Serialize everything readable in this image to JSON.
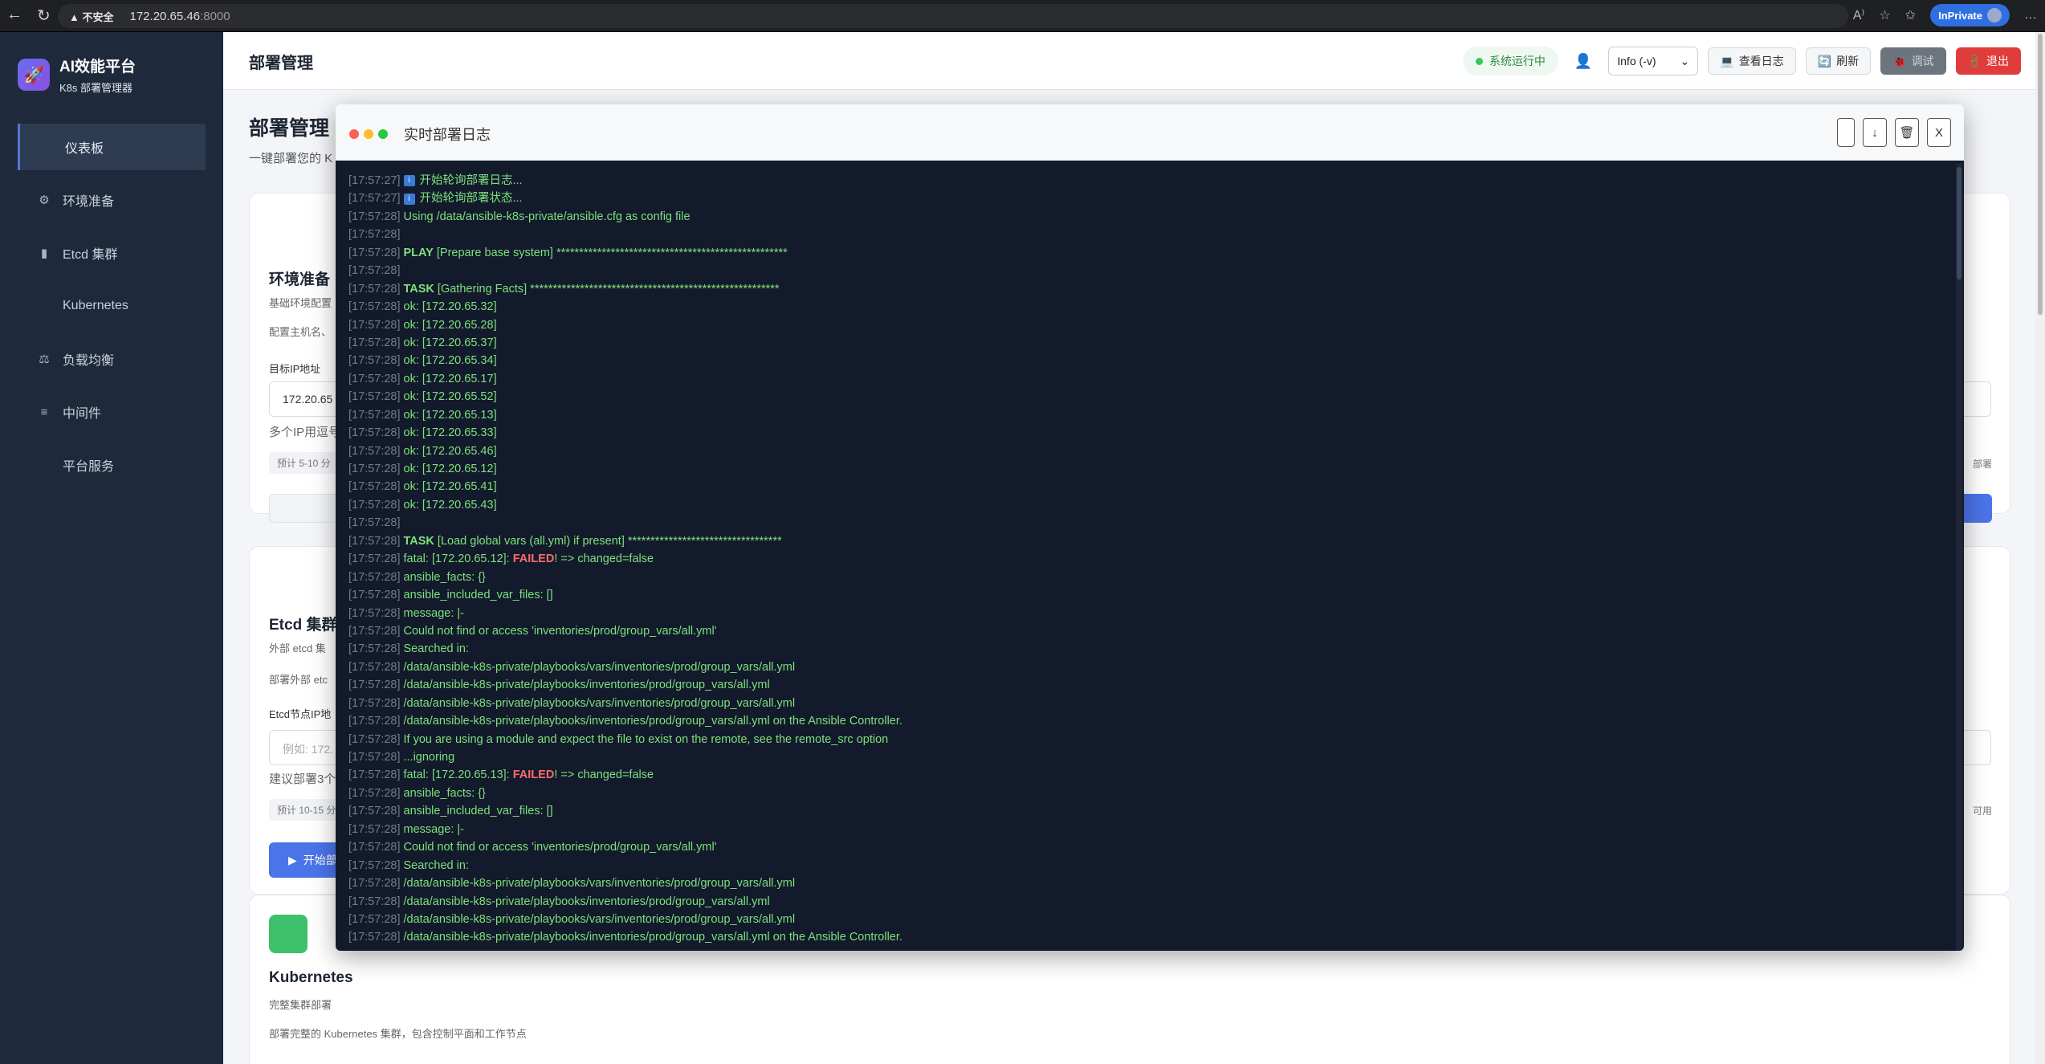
{
  "browser": {
    "security_label": "不安全",
    "url_host": "172.20.65.46",
    "url_port": ":8000",
    "inprivate_label": "InPrivate"
  },
  "sidebar": {
    "brand_title": "AI效能平台",
    "brand_subtitle": "K8s 部署管理器",
    "items": [
      {
        "label": "仪表板",
        "icon": "dashboard",
        "active": true
      },
      {
        "label": "环境准备",
        "icon": "gear-icon"
      },
      {
        "label": "Etcd 集群",
        "icon": "database-icon"
      },
      {
        "label": "Kubernetes",
        "icon": ""
      },
      {
        "label": "负载均衡",
        "icon": "scale-icon"
      },
      {
        "label": "中间件",
        "icon": "stack-icon"
      },
      {
        "label": "平台服务",
        "icon": ""
      }
    ]
  },
  "header": {
    "title": "部署管理",
    "status": "系统运行中",
    "log_level": "Info (-v)",
    "view_logs": "查看日志",
    "refresh": "刷新",
    "debug": "调试",
    "logout": "退出"
  },
  "main": {
    "page_title": "部署管理",
    "page_subtitle": "一键部署您的 K",
    "env": {
      "title": "环境准备",
      "desc1": "基础环境配置",
      "desc2": "配置主机名、",
      "ip_label": "目标IP地址",
      "ip_value": "172.20.65",
      "ip_hint": "多个IP用逗号",
      "eta": "预计 5-10 分",
      "right_note": "部署"
    },
    "etcd": {
      "title": "Etcd 集群",
      "desc1": "外部 etcd 集",
      "desc2": "部署外部 etc",
      "ip_label": "Etcd节点IP地",
      "ip_placeholder": "例如: 172.",
      "hint": "建议部署3个",
      "eta": "预计 10-15 分",
      "right_note": "可用",
      "start_btn": "开始部"
    },
    "k8s": {
      "title": "Kubernetes",
      "desc1": "完整集群部署",
      "desc2": "部署完整的 Kubernetes 集群，包含控制平面和工作节点"
    }
  },
  "modal": {
    "title": "实时部署日志",
    "tools": [
      "",
      "↓",
      "🗑",
      "X"
    ],
    "log_lines": [
      {
        "ts": "[17:57:27]",
        "icon": true,
        "text": "开始轮询部署日志..."
      },
      {
        "ts": "[17:57:27]",
        "icon": true,
        "text": "开始轮询部署状态..."
      },
      {
        "ts": "[17:57:28]",
        "text": "Using /data/ansible-k8s-private/ansible.cfg as config file"
      },
      {
        "ts": "[17:57:28]",
        "text": ""
      },
      {
        "ts": "[17:57:28]",
        "kw": "PLAY",
        "text": " [Prepare base system] ***************************************************"
      },
      {
        "ts": "[17:57:28]",
        "text": ""
      },
      {
        "ts": "[17:57:28]",
        "kw": "TASK",
        "text": " [Gathering Facts] *******************************************************"
      },
      {
        "ts": "[17:57:28]",
        "text": "ok: [172.20.65.32]"
      },
      {
        "ts": "[17:57:28]",
        "text": "ok: [172.20.65.28]"
      },
      {
        "ts": "[17:57:28]",
        "text": "ok: [172.20.65.37]"
      },
      {
        "ts": "[17:57:28]",
        "text": "ok: [172.20.65.34]"
      },
      {
        "ts": "[17:57:28]",
        "text": "ok: [172.20.65.17]"
      },
      {
        "ts": "[17:57:28]",
        "text": "ok: [172.20.65.52]"
      },
      {
        "ts": "[17:57:28]",
        "text": "ok: [172.20.65.13]"
      },
      {
        "ts": "[17:57:28]",
        "text": "ok: [172.20.65.33]"
      },
      {
        "ts": "[17:57:28]",
        "text": "ok: [172.20.65.46]"
      },
      {
        "ts": "[17:57:28]",
        "text": "ok: [172.20.65.12]"
      },
      {
        "ts": "[17:57:28]",
        "text": "ok: [172.20.65.41]"
      },
      {
        "ts": "[17:57:28]",
        "text": "ok: [172.20.65.43]"
      },
      {
        "ts": "[17:57:28]",
        "text": ""
      },
      {
        "ts": "[17:57:28]",
        "kw": "TASK",
        "text": " [Load global vars (all.yml) if present] **********************************"
      },
      {
        "ts": "[17:57:28]",
        "pre": "fatal: [172.20.65.12]: ",
        "fail": "FAILED",
        "text": "! => changed=false"
      },
      {
        "ts": "[17:57:28]",
        "text": "ansible_facts: {}"
      },
      {
        "ts": "[17:57:28]",
        "text": "ansible_included_var_files: []"
      },
      {
        "ts": "[17:57:28]",
        "text": "message: |-"
      },
      {
        "ts": "[17:57:28]",
        "text": "Could not find or access 'inventories/prod/group_vars/all.yml'"
      },
      {
        "ts": "[17:57:28]",
        "text": "Searched in:"
      },
      {
        "ts": "[17:57:28]",
        "text": "/data/ansible-k8s-private/playbooks/vars/inventories/prod/group_vars/all.yml"
      },
      {
        "ts": "[17:57:28]",
        "text": "/data/ansible-k8s-private/playbooks/inventories/prod/group_vars/all.yml"
      },
      {
        "ts": "[17:57:28]",
        "text": "/data/ansible-k8s-private/playbooks/vars/inventories/prod/group_vars/all.yml"
      },
      {
        "ts": "[17:57:28]",
        "text": "/data/ansible-k8s-private/playbooks/inventories/prod/group_vars/all.yml on the Ansible Controller."
      },
      {
        "ts": "[17:57:28]",
        "text": "If you are using a module and expect the file to exist on the remote, see the remote_src option"
      },
      {
        "ts": "[17:57:28]",
        "text": "...ignoring"
      },
      {
        "ts": "[17:57:28]",
        "pre": "fatal: [172.20.65.13]: ",
        "fail": "FAILED",
        "text": "! => changed=false"
      },
      {
        "ts": "[17:57:28]",
        "text": "ansible_facts: {}"
      },
      {
        "ts": "[17:57:28]",
        "text": "ansible_included_var_files: []"
      },
      {
        "ts": "[17:57:28]",
        "text": "message: |-"
      },
      {
        "ts": "[17:57:28]",
        "text": "Could not find or access 'inventories/prod/group_vars/all.yml'"
      },
      {
        "ts": "[17:57:28]",
        "text": "Searched in:"
      },
      {
        "ts": "[17:57:28]",
        "text": "/data/ansible-k8s-private/playbooks/vars/inventories/prod/group_vars/all.yml"
      },
      {
        "ts": "[17:57:28]",
        "text": "/data/ansible-k8s-private/playbooks/inventories/prod/group_vars/all.yml"
      },
      {
        "ts": "[17:57:28]",
        "text": "/data/ansible-k8s-private/playbooks/vars/inventories/prod/group_vars/all.yml"
      },
      {
        "ts": "[17:57:28]",
        "text": "/data/ansible-k8s-private/playbooks/inventories/prod/group_vars/all.yml on the Ansible Controller."
      }
    ]
  }
}
